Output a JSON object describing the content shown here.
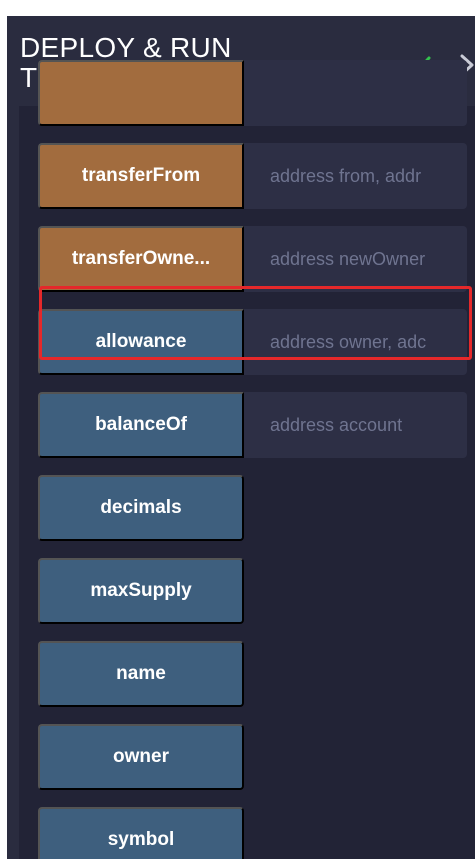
{
  "header": {
    "title": "DEPLOY & RUN\nTRANSACTIONS",
    "check_icon": "check-icon",
    "chevron_icon": "chevron-right-icon",
    "check_color": "#33c24d"
  },
  "colors": {
    "write_button": "#a26c3e",
    "read_button": "#3e5f7e",
    "input_bg": "#2d2f45",
    "panel_bg": "#222336",
    "header_bg": "#2a2c3f",
    "highlight": "#e5282a"
  },
  "functions": [
    {
      "label": "",
      "kind": "write",
      "placeholder": ""
    },
    {
      "label": "transferFrom",
      "kind": "write",
      "placeholder": "address from, addr"
    },
    {
      "label": "transferOwne...",
      "kind": "write",
      "placeholder": "address newOwner"
    },
    {
      "label": "allowance",
      "kind": "read",
      "placeholder": "address owner, adc"
    },
    {
      "label": "balanceOf",
      "kind": "read",
      "placeholder": "address account",
      "highlighted": true
    },
    {
      "label": "decimals",
      "kind": "read"
    },
    {
      "label": "maxSupply",
      "kind": "read"
    },
    {
      "label": "name",
      "kind": "read"
    },
    {
      "label": "owner",
      "kind": "read"
    },
    {
      "label": "symbol",
      "kind": "read"
    }
  ]
}
